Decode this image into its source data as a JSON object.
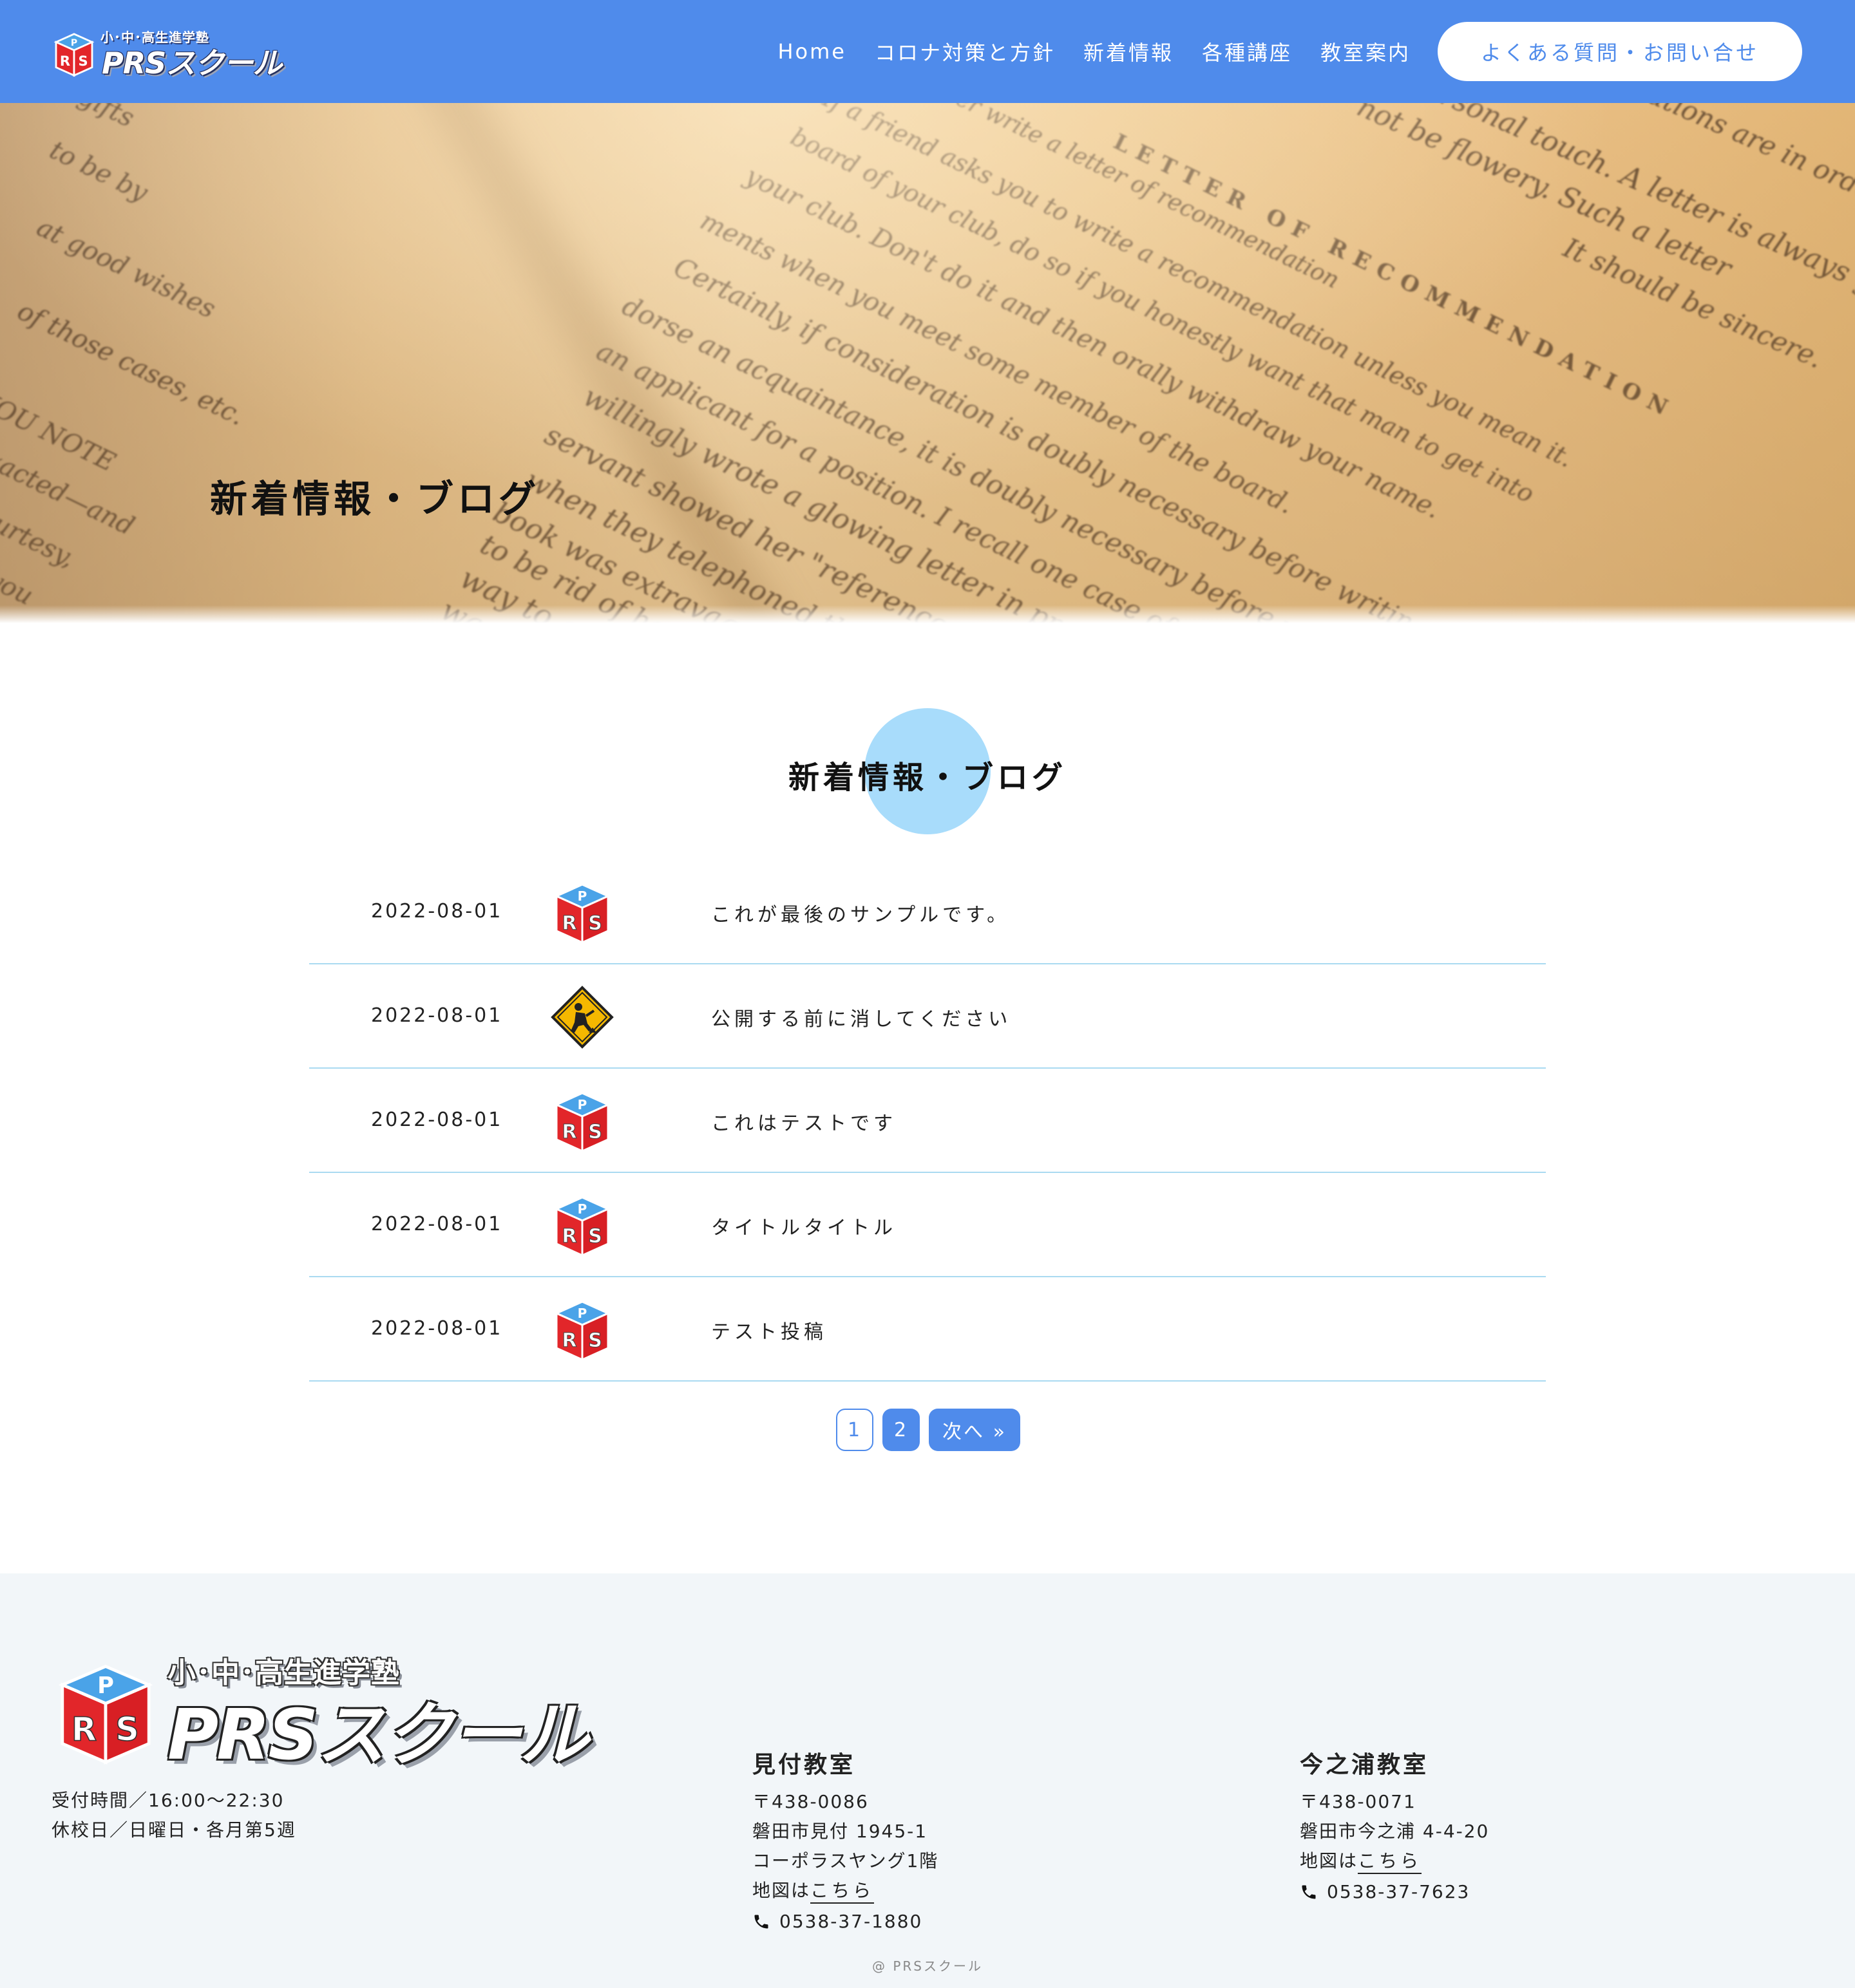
{
  "header": {
    "logo_sub": "小･中･高生進学塾",
    "logo_main": "PRSスクール",
    "nav": [
      "Home",
      "コロナ対策と方針",
      "新着情報",
      "各種講座",
      "教室案内"
    ],
    "cta": "よくある質問・お問い合せ"
  },
  "hero": {
    "title": "新着情報・ブログ"
  },
  "section": {
    "title": "新着情報・ブログ"
  },
  "posts": [
    {
      "date": "2022-08-01",
      "thumb": "prs-logo-icon",
      "title": "これが最後のサンプルです。"
    },
    {
      "date": "2022-08-01",
      "thumb": "construction-sign-icon",
      "title": "公開する前に消してください"
    },
    {
      "date": "2022-08-01",
      "thumb": "prs-logo-icon",
      "title": "これはテストです"
    },
    {
      "date": "2022-08-01",
      "thumb": "prs-logo-icon",
      "title": "タイトルタイトル"
    },
    {
      "date": "2022-08-01",
      "thumb": "prs-logo-icon",
      "title": "テスト投稿"
    }
  ],
  "pagination": {
    "current": "1",
    "pages": [
      "2"
    ],
    "next": "次へ »"
  },
  "footer": {
    "logo_sub": "小･中･高生進学塾",
    "logo_main": "PRSスクール",
    "hours": "受付時間／16:00〜22:30",
    "holidays": "休校日／日曜日・各月第5週",
    "branches": [
      {
        "name": "見付教室",
        "postal": "〒438-0086",
        "address": [
          "磐田市見付 1945-1",
          "コーポラスヤング1階"
        ],
        "map_prefix": "地図は",
        "map_link": "こちら",
        "phone": "0538-37-1880"
      },
      {
        "name": "今之浦教室",
        "postal": "〒438-0071",
        "address": [
          "磐田市今之浦 4-4-20"
        ],
        "map_prefix": "地図は",
        "map_link": "こちら",
        "phone": "0538-37-7623"
      }
    ],
    "copyright": "@ PRSスクール"
  },
  "colors": {
    "header_bg": "#4f8beb",
    "accent_circle": "#a8dcfb",
    "row_divider": "#aadaf1",
    "footer_bg": "#f2f6f9"
  },
  "hero_image_text": [
    "Never write a letter of recommendation",
    "If a friend asks you to write a recommendation unless you mean it.",
    "board of your club, do so if you honestly want that man to get into",
    "your club.  Don't do it and then orally withdraw your name.",
    "ments when you meet some member of the board.",
    "Certainly, if consideration is doubly necessary before writing",
    "dorse an acquaintance, it is doubly necessary before writing",
    "an applicant for a position.  I recall one case of",
    "willingly wrote a glowing letter in praise of a",
    "servant showed her \"references\" to the",
    "when they telephoned the woman",
    "book was extravagant and",
    "to be rid of her.  Possibly",
    "way to get out of",
    "was dishonest",
    "LETTER OF RECOMMENDATION",
    "personal touch.  A letter is always good",
    "not be flowery.  Such a letter",
    "It should be sincere.",
    "situations are in order",
    "YOU NOTE",
    "exacted—and",
    "courtesy,",
    "k-you",
    "fair gifts",
    "to be by",
    "at good wishes",
    "of those cases, etc."
  ]
}
